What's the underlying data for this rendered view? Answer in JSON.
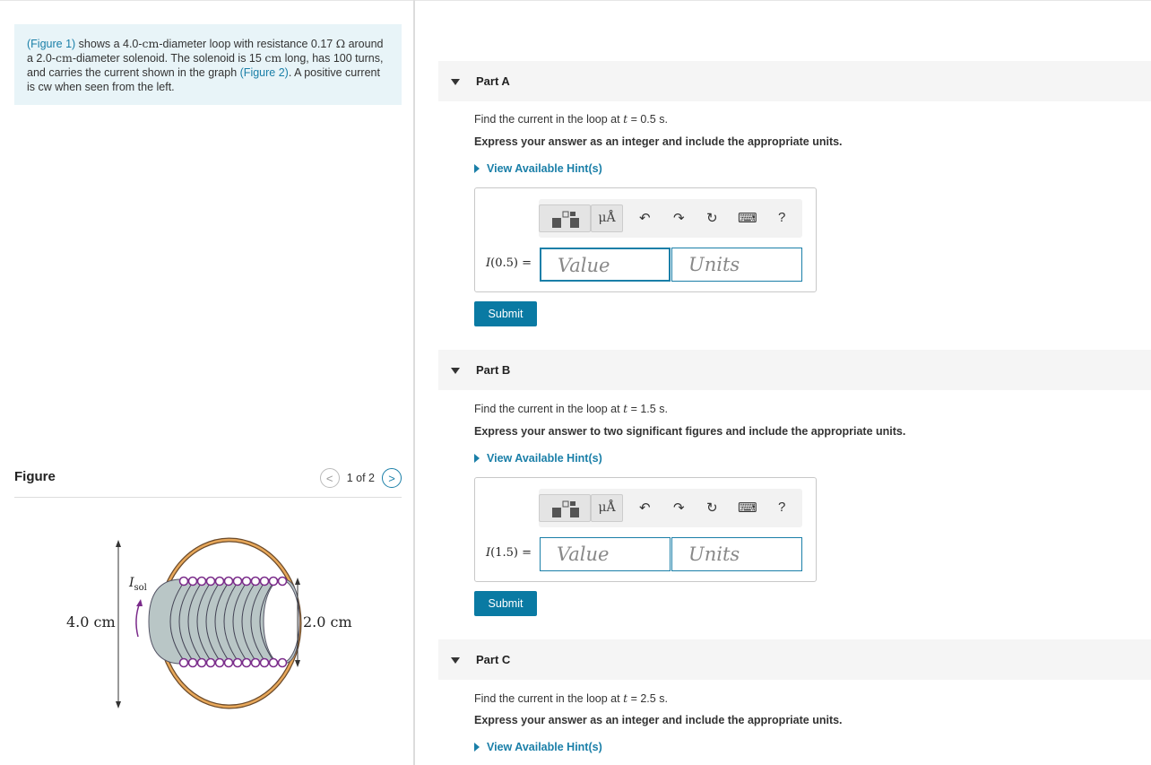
{
  "problem": {
    "fig1_link": "(Figure 1)",
    "text_1": " shows a 4.0-",
    "unit_cm": "cm",
    "text_2": "-diameter loop with resistance 0.17 ",
    "unit_ohm": "Ω",
    "text_3": " around a 2.0-",
    "text_4": "-diameter solenoid.  The solenoid is 15 ",
    "text_5": " long, has 100 turns, and carries the current shown in the graph ",
    "fig2_link": "(Figure 2)",
    "text_6": ". A positive current is cw when seen from the left."
  },
  "figure": {
    "title": "Figure",
    "pager": "1 of 2",
    "prev": "<",
    "next": ">",
    "label_loop": "4.0 cm",
    "label_sol": "2.0 cm",
    "label_current": "I",
    "label_current_sub": "sol"
  },
  "parts": [
    {
      "title": "Part A",
      "q_prefix": "Find the current in the loop at ",
      "q_var": "t",
      "q_suffix": " = 0.5 s.",
      "instruction": "Express your answer as an integer and include the appropriate units.",
      "hint": "View Available Hint(s)",
      "eq_fn": "I",
      "eq_arg": "(0.5) =",
      "value_placeholder": "Value",
      "units_placeholder": "Units",
      "submit": "Submit"
    },
    {
      "title": "Part B",
      "q_prefix": "Find the current in the loop at ",
      "q_var": "t",
      "q_suffix": " = 1.5 s.",
      "instruction": "Express your answer to two significant figures and include the appropriate units.",
      "hint": "View Available Hint(s)",
      "eq_fn": "I",
      "eq_arg": "(1.5) =",
      "value_placeholder": "Value",
      "units_placeholder": "Units",
      "submit": "Submit"
    },
    {
      "title": "Part C",
      "q_prefix": "Find the current in the loop at ",
      "q_var": "t",
      "q_suffix": " = 2.5 s.",
      "instruction": "Express your answer as an integer and include the appropriate units.",
      "hint": "View Available Hint(s)"
    }
  ],
  "toolbar": {
    "units_btn": "μÅ",
    "undo": "↶",
    "redo": "↷",
    "reset": "↻",
    "keyboard": "⌨",
    "help": "?"
  }
}
